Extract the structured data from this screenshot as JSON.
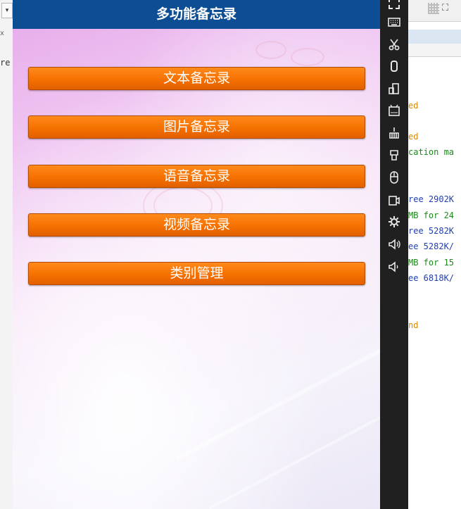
{
  "ide_left": {
    "dropdown": "▾",
    "tab_fragment": "x",
    "code_fragment": "re"
  },
  "app": {
    "title": "多功能备忘录",
    "buttons": [
      {
        "label": "文本备忘录"
      },
      {
        "label": "图片备忘录"
      },
      {
        "label": "语音备忘录"
      },
      {
        "label": "视频备忘录"
      },
      {
        "label": "类别管理"
      }
    ],
    "colors": {
      "titlebar": "#0c4d93",
      "button": "#f57100",
      "toolbar": "#202020"
    }
  },
  "emulator_toolbar": [
    {
      "name": "expand-icon"
    },
    {
      "name": "keyboard-icon"
    },
    {
      "name": "scissors-icon"
    },
    {
      "name": "rotate-icon"
    },
    {
      "name": "screen-rotate-icon"
    },
    {
      "name": "apk-icon"
    },
    {
      "name": "clean-icon"
    },
    {
      "name": "share-icon"
    },
    {
      "name": "mouse-icon"
    },
    {
      "name": "screenshot-icon"
    },
    {
      "name": "settings-icon"
    },
    {
      "name": "volume-up-icon"
    },
    {
      "name": "volume-down-icon"
    }
  ],
  "ide_right": {
    "expand_glyph": "⛶",
    "log_lines": [
      {
        "text": "ed",
        "color": "#d98a00"
      },
      {
        "text": "ed",
        "color": "#d98a00"
      },
      {
        "text": "cation ma",
        "color": "#1a8a1a"
      },
      {
        "text": "ree 2902K",
        "color": "#1f3fb0"
      },
      {
        "text": "MB for 24",
        "color": "#1a8a1a"
      },
      {
        "text": "ree 5282K",
        "color": "#1f3fb0"
      },
      {
        "text": "ee 5282K/",
        "color": "#1f3fb0"
      },
      {
        "text": "MB for 15",
        "color": "#1a8a1a"
      },
      {
        "text": "ee 6818K/",
        "color": "#1f3fb0"
      },
      {
        "text": "nd",
        "color": "#d98a00"
      }
    ]
  }
}
